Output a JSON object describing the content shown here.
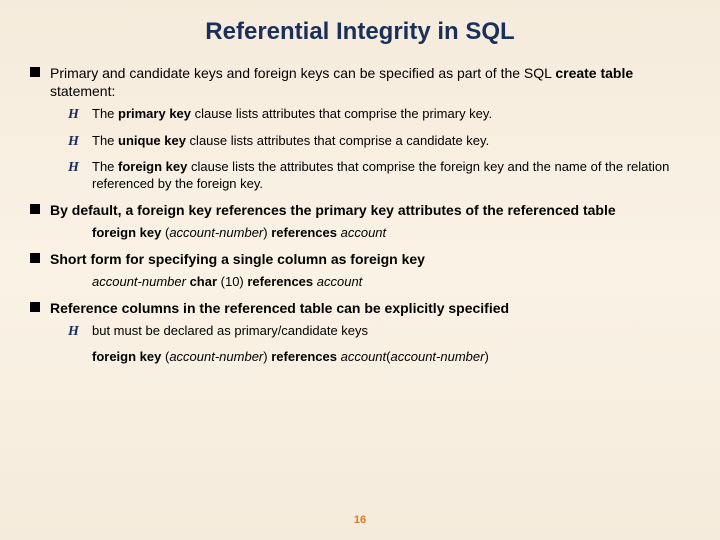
{
  "title": "Referential Integrity in SQL",
  "b1_pre": "Primary and candidate keys and foreign keys can be specified as part of the SQL ",
  "b1_bold": "create table",
  "b1_post": " statement:",
  "b1a_pre": "The ",
  "b1a_bold": "primary key",
  "b1a_post": " clause lists attributes that comprise the primary key.",
  "b1b_pre": "The ",
  "b1b_bold": "unique key",
  "b1b_post": " clause lists attributes that comprise a candidate key.",
  "b1c_pre": "The ",
  "b1c_bold": "foreign key",
  "b1c_post": " clause lists the attributes that comprise the foreign key and the name of the relation referenced by the foreign key.",
  "b2": "By default, a foreign key references the primary key attributes of the referenced table",
  "b2code_fk": "foreign key ",
  "b2code_paren1": "(",
  "b2code_acc": "account-number",
  "b2code_paren2": ") ",
  "b2code_ref": "references ",
  "b2code_acct": "account",
  "b3": "Short form for specifying a single column as foreign key",
  "b3code_col": "account-number",
  "b3code_type": " char ",
  "b3code_len": "(10) ",
  "b3code_ref": "references ",
  "b3code_acct": "account",
  "b4": "Reference columns in the referenced table can be explicitly specified",
  "b4a": "but must be declared as primary/candidate keys",
  "b4code_fk": "foreign key ",
  "b4code_p1": "(",
  "b4code_a1": "account-number",
  "b4code_p2": ") ",
  "b4code_ref": "references ",
  "b4code_acct": "account",
  "b4code_p3": "(",
  "b4code_a2": "account-number",
  "b4code_p4": ")",
  "page_number": "16",
  "script_marker": "H"
}
